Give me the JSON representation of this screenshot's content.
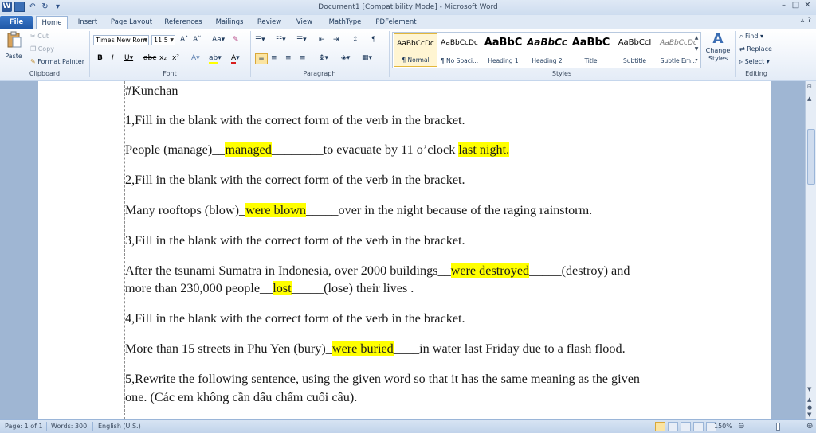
{
  "window": {
    "title": "Document1 [Compatibility Mode]  -  Microsoft Word",
    "app_icon_letter": "W"
  },
  "tabs": [
    "File",
    "Home",
    "Insert",
    "Page Layout",
    "References",
    "Mailings",
    "Review",
    "View",
    "MathType",
    "PDFelement"
  ],
  "clipboard": {
    "paste": "Paste",
    "cut": "Cut",
    "copy": "Copy",
    "format_painter": "Format Painter",
    "label": "Clipboard"
  },
  "font": {
    "name": "Times New Rom",
    "size": "11.5",
    "label": "Font"
  },
  "paragraph": {
    "label": "Paragraph"
  },
  "styles": {
    "label": "Styles",
    "items": [
      {
        "sample": "AaBbCcDc",
        "name": "¶ Normal"
      },
      {
        "sample": "AaBbCcDc",
        "name": "¶ No Spaci..."
      },
      {
        "sample": "AaBbC",
        "name": "Heading 1"
      },
      {
        "sample": "AaBbCc",
        "name": "Heading 2"
      },
      {
        "sample": "AaBbC",
        "name": "Title"
      },
      {
        "sample": "AaBbCcI",
        "name": "Subtitle"
      },
      {
        "sample": "AaBbCcDc",
        "name": "Subtle Em..."
      }
    ],
    "change_styles": "Change Styles"
  },
  "editing": {
    "find": "Find",
    "replace": "Replace",
    "select": "Select",
    "label": "Editing"
  },
  "document": {
    "paragraphs": [
      {
        "segments": [
          {
            "t": "#Kunchan"
          }
        ]
      },
      {
        "segments": [
          {
            "t": "1,Fill in the blank with the correct form of the verb in the bracket."
          }
        ]
      },
      {
        "segments": [
          {
            "t": " People (manage)__"
          },
          {
            "t": "managed",
            "hl": true
          },
          {
            "t": "________to evacuate by 11 o’clock "
          },
          {
            "t": "last night.",
            "hl": true
          }
        ]
      },
      {
        "segments": [
          {
            "t": "2,Fill in the blank with the correct form of the verb in the bracket."
          }
        ]
      },
      {
        "segments": [
          {
            "t": "Many rooftops (blow)_"
          },
          {
            "t": "were blown",
            "hl": true
          },
          {
            "t": "_____over in the night because of the raging rainstorm."
          }
        ]
      },
      {
        "segments": [
          {
            "t": "3,Fill in the blank with the correct form of the verb in the bracket."
          }
        ]
      },
      {
        "segments": [
          {
            "t": "After the tsunami Sumatra in Indonesia, over 2000 buildings__"
          },
          {
            "t": "were destroyed",
            "hl": true
          },
          {
            "t": "_____(destroy) and"
          }
        ]
      },
      {
        "segments": [
          {
            "t": "more than 230,000 people__"
          },
          {
            "t": "lost",
            "hl": true
          },
          {
            "t": "_____(lose) their lives ."
          }
        ]
      },
      {
        "segments": [
          {
            "t": "4,Fill in the blank with the correct form of the verb in the bracket."
          }
        ]
      },
      {
        "segments": [
          {
            "t": "More than 15 streets in Phu Yen (bury)_"
          },
          {
            "t": "were buried",
            "hl": true
          },
          {
            "t": "____in water last Friday due to a flash flood."
          }
        ]
      },
      {
        "segments": [
          {
            "t": "5,Rewrite the following sentence, using the given word so that it has the same meaning as the given"
          }
        ]
      },
      {
        "segments": [
          {
            "t": "one. (Các em không cần dấu chấm cuối câu)."
          }
        ]
      }
    ]
  },
  "status": {
    "page": "Page: 1 of 1",
    "words": "Words: 300",
    "language": "English (U.S.)",
    "zoom": "150%"
  },
  "colors": {
    "highlight": "#ffff00",
    "file_tab": "#2b66b8"
  }
}
